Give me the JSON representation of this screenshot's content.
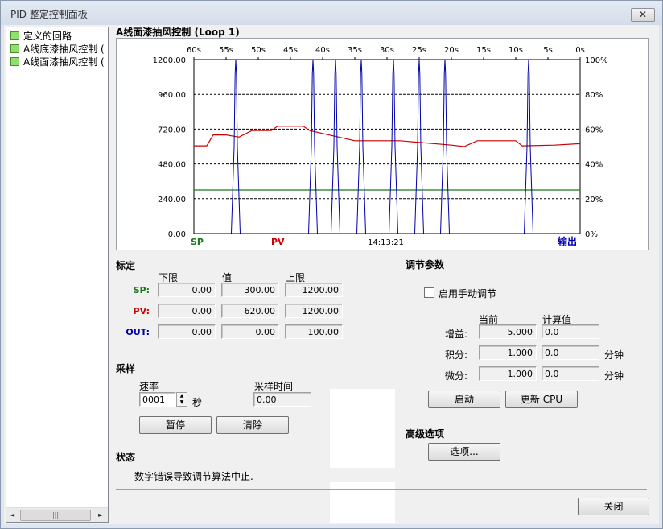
{
  "window": {
    "title": "PID 整定控制面板",
    "close_glyph": "✕"
  },
  "tree": {
    "items": [
      "定义的回路",
      "A线底漆抽风控制 (",
      "A线面漆抽风控制 ("
    ],
    "scroll_left": "◄",
    "scroll_right": "►",
    "scroll_thumb": "|||"
  },
  "plot": {
    "title": "A线面漆抽风控制 (Loop 1)",
    "sp_label": "SP",
    "pv_label": "PV",
    "time": "14:13:21",
    "out_label": "输出"
  },
  "chart_data": {
    "type": "line",
    "x_ticks": [
      "60s",
      "55s",
      "50s",
      "45s",
      "40s",
      "35s",
      "30s",
      "25s",
      "20s",
      "15s",
      "10s",
      "5s",
      "0s"
    ],
    "y_ticks_left": [
      "1200.00",
      "960.00",
      "720.00",
      "480.00",
      "240.00",
      "0.00"
    ],
    "y_ticks_right": [
      "100%",
      "80%",
      "60%",
      "40%",
      "20%",
      "0%"
    ],
    "ylim": [
      0,
      1200
    ],
    "xlim": [
      60,
      0
    ],
    "grid": true,
    "colors": {
      "sp": "#1a7a1a",
      "pv": "#cc0000",
      "out": "#0000aa"
    },
    "series": [
      {
        "name": "SP",
        "points": [
          [
            60,
            300
          ],
          [
            0,
            300
          ]
        ]
      },
      {
        "name": "PV",
        "points": [
          [
            60,
            605
          ],
          [
            58,
            605
          ],
          [
            57,
            680
          ],
          [
            55,
            680
          ],
          [
            53,
            665
          ],
          [
            51,
            710
          ],
          [
            48,
            710
          ],
          [
            47,
            740
          ],
          [
            43,
            740
          ],
          [
            42,
            710
          ],
          [
            38,
            670
          ],
          [
            35,
            640
          ],
          [
            28,
            640
          ],
          [
            20,
            610
          ],
          [
            18,
            600
          ],
          [
            16,
            640
          ],
          [
            10,
            640
          ],
          [
            9,
            605
          ],
          [
            4,
            610
          ],
          [
            0,
            620
          ]
        ]
      },
      {
        "name": "输出",
        "spikes": [
          53.5,
          41.5,
          38,
          34,
          29,
          25,
          21,
          8
        ]
      }
    ]
  },
  "setpoint": {
    "title": "标定",
    "headers": [
      "下限",
      "值",
      "上限"
    ],
    "rows": [
      {
        "label": "SP:",
        "low": "0.00",
        "value": "300.00",
        "high": "1200.00"
      },
      {
        "label": "PV:",
        "low": "0.00",
        "value": "620.00",
        "high": "1200.00"
      },
      {
        "label": "OUT:",
        "low": "0.00",
        "value": "0.00",
        "high": "100.00"
      }
    ]
  },
  "sampling": {
    "title": "采样",
    "rate_label": "速率",
    "rate_value": "0001",
    "rate_unit": "秒",
    "time_label": "采样时间",
    "time_value": "0.00",
    "pause_label": "暂停",
    "clear_label": "清除"
  },
  "status": {
    "title": "状态",
    "text": "数字错误导致调节算法中止."
  },
  "tuning": {
    "title": "调节参数",
    "manual_label": "启用手动调节",
    "col_current": "当前",
    "col_calc": "计算值",
    "rows": [
      {
        "label": "增益:",
        "current": "5.000",
        "calc": "0.0",
        "unit": ""
      },
      {
        "label": "积分:",
        "current": "1.000",
        "calc": "0.0",
        "unit": "分钟"
      },
      {
        "label": "微分:",
        "current": "1.000",
        "calc": "0.0",
        "unit": "分钟"
      }
    ],
    "start_label": "启动",
    "update_label": "更新 CPU"
  },
  "advanced": {
    "title": "高级选项",
    "options_label": "选项..."
  },
  "close_label": "关闭"
}
